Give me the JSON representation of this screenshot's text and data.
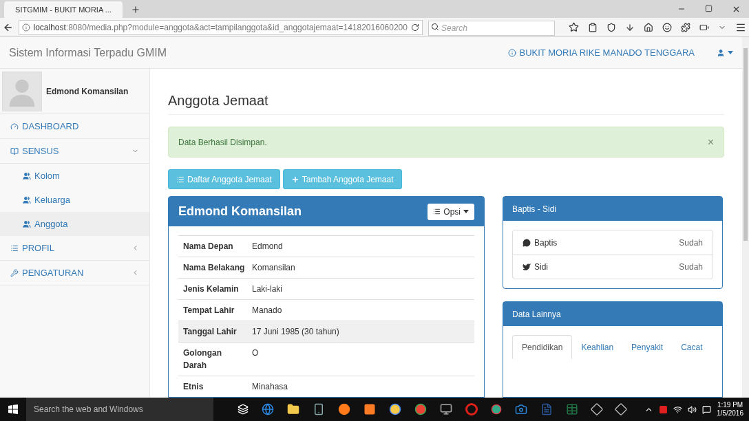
{
  "browser": {
    "tab_title": "SITGMIM - BUKIT MORIA ...",
    "url_host": "localhost",
    "url_rest": ":8080/media.php?module=anggota&act=tampilanggota&id_anggotajemaat=14182016060200",
    "search_placeholder": "Search"
  },
  "navbar": {
    "brand": "Sistem Informasi Terpadu GMIM",
    "church": "BUKIT MORIA RIKE MANADO TENGGARA"
  },
  "user": {
    "name": "Edmond Komansilan"
  },
  "sidebar": {
    "items": [
      {
        "label": "DASHBOARD"
      },
      {
        "label": "SENSUS",
        "expanded": true,
        "children": [
          {
            "label": "Kolom",
            "selected": false
          },
          {
            "label": "Keluarga",
            "selected": false
          },
          {
            "label": "Anggota",
            "selected": true
          }
        ]
      },
      {
        "label": "PROFIL",
        "expanded": false
      },
      {
        "label": "PENGATURAN",
        "expanded": false
      }
    ]
  },
  "page": {
    "title": "Anggota Jemaat",
    "alert": "Data Berhasil Disimpan.",
    "alert_close": "×",
    "buttons": [
      "Daftar Anggota Jemaat",
      "Tambah Anggota Jemaat"
    ]
  },
  "member_panel": {
    "title": "Edmond Komansilan",
    "options_button": "Opsi",
    "rows": [
      {
        "label": "Nama Depan",
        "value": "Edmond",
        "highlighted": false
      },
      {
        "label": "Nama Belakang",
        "value": "Komansilan",
        "highlighted": false
      },
      {
        "label": "Jenis Kelamin",
        "value": "Laki-laki",
        "highlighted": false
      },
      {
        "label": "Tempat Lahir",
        "value": "Manado",
        "highlighted": false
      },
      {
        "label": "Tanggal Lahir",
        "value": "17 Juni 1985 (30 tahun)",
        "highlighted": true
      },
      {
        "label": "Golongan Darah",
        "value": "O",
        "highlighted": false
      },
      {
        "label": "Etnis",
        "value": "Minahasa",
        "highlighted": false
      }
    ]
  },
  "baptis_panel": {
    "title": "Baptis - Sidi",
    "items": [
      {
        "label": "Baptis",
        "status": "Sudah"
      },
      {
        "label": "Sidi",
        "status": "Sudah"
      }
    ]
  },
  "other_panel": {
    "title": "Data Lainnya",
    "tabs": [
      {
        "label": "Pendidikan",
        "selected": true
      },
      {
        "label": "Keahlian",
        "selected": false
      },
      {
        "label": "Penyakit",
        "selected": false
      },
      {
        "label": "Cacat",
        "selected": false
      }
    ]
  },
  "taskbar": {
    "search_placeholder": "Search the web and Windows",
    "time": "1:19 PM",
    "date": "1/5/2016"
  }
}
